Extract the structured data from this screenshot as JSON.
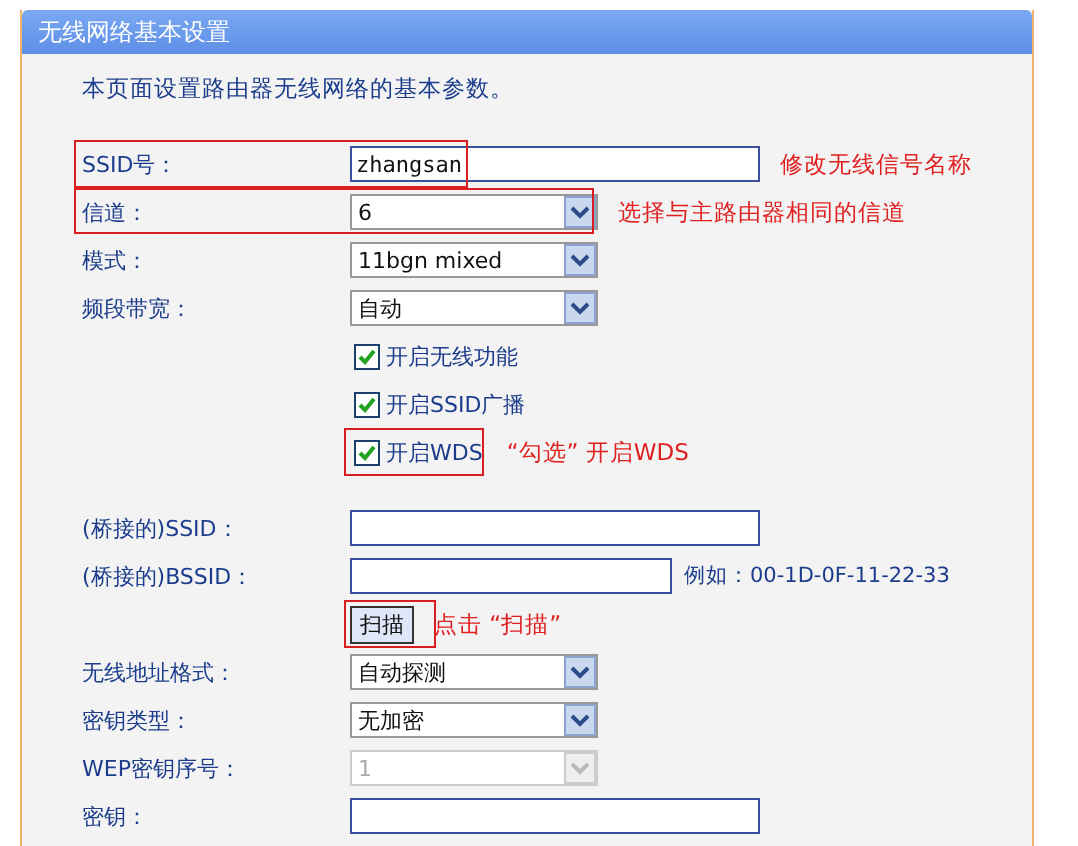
{
  "panel": {
    "title": "无线网络基本设置"
  },
  "intro": "本页面设置路由器无线网络的基本参数。",
  "rows": [
    {
      "kind": "input",
      "label": "SSID号：",
      "value": "zhangsan",
      "highlight": true,
      "note": "修改无线信号名称"
    },
    {
      "kind": "select",
      "label": "信道：",
      "value": "6",
      "highlight": true,
      "note": "选择与主路由器相同的信道",
      "disabled": false
    },
    {
      "kind": "select",
      "label": "模式：",
      "value": "11bgn mixed",
      "highlight": false,
      "disabled": false
    },
    {
      "kind": "select",
      "label": "频段带宽：",
      "value": "自动",
      "highlight": false,
      "disabled": false
    },
    {
      "kind": "checkbox",
      "label": "开启无线功能",
      "checked": true,
      "highlight": false
    },
    {
      "kind": "checkbox",
      "label": "开启SSID广播",
      "checked": true,
      "highlight": false
    },
    {
      "kind": "checkbox",
      "label": "开启WDS",
      "checked": true,
      "highlight": true,
      "note": "“勾选” 开启WDS"
    },
    {
      "kind": "gap"
    },
    {
      "kind": "input",
      "label": "(桥接的)SSID：",
      "value": "",
      "highlight": false
    },
    {
      "kind": "input",
      "label": "(桥接的)BSSID：",
      "value": "",
      "highlight": false,
      "hint": "例如：00-1D-0F-11-22-33"
    },
    {
      "kind": "button",
      "label": "扫描",
      "highlight": true,
      "note": "点击 “扫描”"
    },
    {
      "kind": "select",
      "label": "无线地址格式：",
      "value": "自动探测",
      "highlight": false,
      "disabled": false
    },
    {
      "kind": "select",
      "label": "密钥类型：",
      "value": "无加密",
      "highlight": false,
      "disabled": false
    },
    {
      "kind": "select",
      "label": "WEP密钥序号：",
      "value": "1",
      "highlight": false,
      "disabled": true
    },
    {
      "kind": "input",
      "label": "密钥：",
      "value": "",
      "highlight": false
    }
  ]
}
